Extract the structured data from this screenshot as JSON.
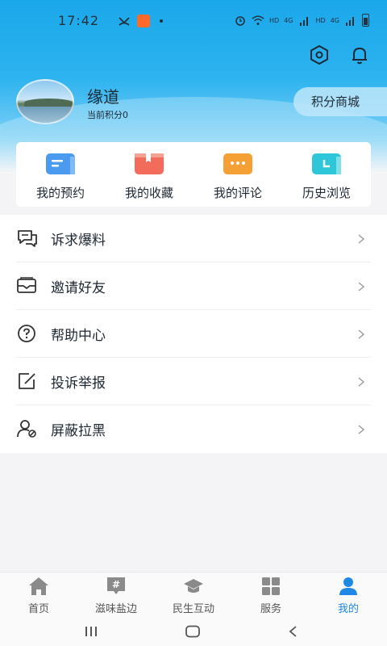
{
  "status_bar": {
    "time": "17:42",
    "hd1": "HD",
    "net1": "4G",
    "hd2": "HD",
    "net2": "4G"
  },
  "header": {
    "settings_icon": "hexagon-settings-icon",
    "notification_icon": "bell-icon"
  },
  "profile": {
    "username": "缘道",
    "points_label": "当前积分0"
  },
  "points_mall": {
    "label": "积分商城"
  },
  "quick_actions": [
    {
      "label": "我的预约",
      "icon": "calendar-icon",
      "color": "#4a9bf0"
    },
    {
      "label": "我的收藏",
      "icon": "bookmark-icon",
      "color": "#f26b5b"
    },
    {
      "label": "我的评论",
      "icon": "comment-icon",
      "color": "#f5a035"
    },
    {
      "label": "历史浏览",
      "icon": "history-icon",
      "color": "#2ec7d9"
    }
  ],
  "menu": [
    {
      "label": "诉求爆料",
      "icon": "chat-bubble-icon"
    },
    {
      "label": "邀请好友",
      "icon": "envelope-icon"
    },
    {
      "label": "帮助中心",
      "icon": "question-icon"
    },
    {
      "label": "投诉举报",
      "icon": "edit-icon"
    },
    {
      "label": "屏蔽拉黑",
      "icon": "user-block-icon"
    }
  ],
  "tabs": [
    {
      "label": "首页",
      "icon": "home-icon",
      "active": false
    },
    {
      "label": "滋味盐边",
      "icon": "hashtag-icon",
      "active": false
    },
    {
      "label": "民生互动",
      "icon": "graduation-cap-icon",
      "active": false
    },
    {
      "label": "服务",
      "icon": "grid-icon",
      "active": false
    },
    {
      "label": "我的",
      "icon": "person-icon",
      "active": true
    }
  ],
  "colors": {
    "accent": "#1e88e5",
    "header_top": "#1aa7ea",
    "text": "#1d2833"
  }
}
